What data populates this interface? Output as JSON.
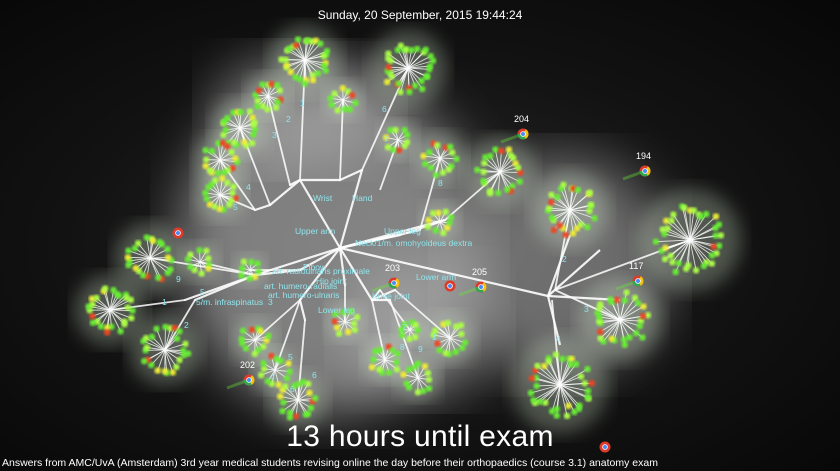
{
  "timestamp": "Sunday, 20 September, 2015 19:44:24",
  "headline": "13 hours until exam",
  "caption": "Answers from AMC/UvA (Amsterdam) 3rd year medical students revising online the day before their orthopaedics (course 3.1) anatomy exam",
  "colors": {
    "branch": "#ffffff",
    "leaf": "#66ee33",
    "leaf_alt": "#aaff44",
    "accent_yellow": "#eeee33",
    "accent_red": "#ee4422",
    "label": "#8ee6ee"
  },
  "labels": [
    "Wrist",
    "Hand",
    "Upper arm",
    "Upper leg",
    "Neck/1/m. omohyoideus dextra",
    "Lower arm",
    "Knee joint",
    "Hip joint",
    "Lower leg",
    "art. radioulnaris proximale",
    "art. humero-radialis",
    "art. humero-ulnaris",
    "Elbow",
    "5/m. infraspinatus"
  ],
  "numbers": [
    "1",
    "2",
    "3",
    "4",
    "5",
    "6",
    "7",
    "8",
    "9"
  ],
  "browsers": [
    {
      "icon": "chrome-icon",
      "count": "204"
    },
    {
      "icon": "chrome-icon",
      "count": "194"
    },
    {
      "icon": "chrome-icon",
      "count": "203"
    },
    {
      "icon": "chrome-icon",
      "count": "205"
    },
    {
      "icon": "chrome-icon",
      "count": "117"
    },
    {
      "icon": "chrome-icon",
      "count": "202"
    }
  ]
}
